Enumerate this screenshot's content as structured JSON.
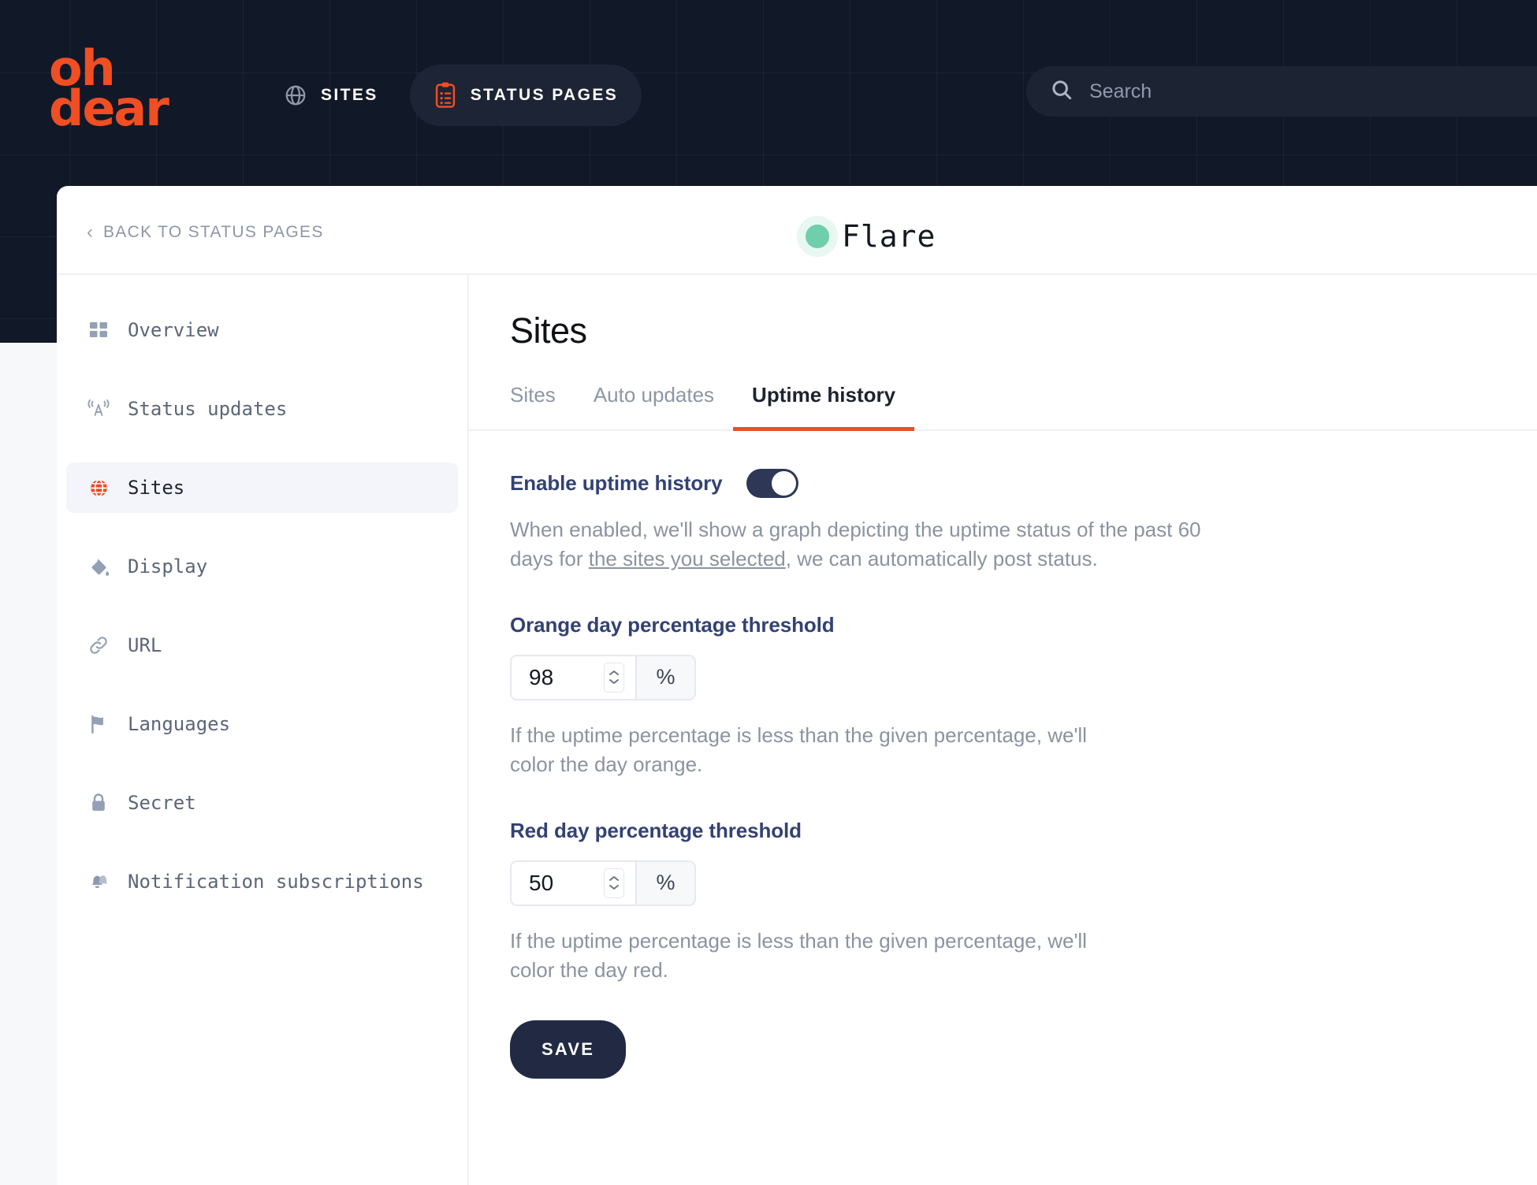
{
  "topnav": {
    "logo_line1": "oh",
    "logo_line2": "dear",
    "items": [
      {
        "label": "SITES",
        "icon": "globe-icon",
        "active": false
      },
      {
        "label": "STATUS PAGES",
        "icon": "clipboard-icon",
        "active": true
      }
    ],
    "search": {
      "placeholder": "Search",
      "icon": "search-icon"
    }
  },
  "card_header": {
    "back_label": "BACK TO STATUS PAGES",
    "back_icon": "chevron-left-icon",
    "status_icon": "green-status-dot",
    "title": "Flare"
  },
  "sidebar": {
    "items": [
      {
        "label": "Overview",
        "icon": "grid-icon",
        "active": false
      },
      {
        "label": "Status updates",
        "icon": "broadcast-icon",
        "active": false
      },
      {
        "label": "Sites",
        "icon": "globe-icon",
        "active": true
      },
      {
        "label": "Display",
        "icon": "paint-bucket-icon",
        "active": false
      },
      {
        "label": "URL",
        "icon": "link-icon",
        "active": false
      },
      {
        "label": "Languages",
        "icon": "flag-icon",
        "active": false
      },
      {
        "label": "Secret",
        "icon": "lock-icon",
        "active": false
      },
      {
        "label": "Notification subscriptions",
        "icon": "bells-icon",
        "active": false
      }
    ]
  },
  "main": {
    "title": "Sites",
    "tabs": [
      {
        "label": "Sites",
        "active": false
      },
      {
        "label": "Auto updates",
        "active": false
      },
      {
        "label": "Uptime history",
        "active": true
      }
    ],
    "enable_uptime": {
      "label": "Enable uptime history",
      "toggle_on": true,
      "helper_pre": "When enabled, we'll show a graph depicting the uptime status of the past 60 days for ",
      "helper_link": "the sites you selected",
      "helper_post": ", we can automatically post status."
    },
    "orange_threshold": {
      "label": "Orange day percentage threshold",
      "value": "98",
      "suffix": "%",
      "helper": "If the uptime percentage is less than the given percentage, we'll color the day orange."
    },
    "red_threshold": {
      "label": "Red day percentage threshold",
      "value": "50",
      "suffix": "%",
      "helper": "If the uptime percentage is less than the given percentage, we'll color the day red."
    },
    "save_label": "SAVE"
  },
  "colors": {
    "brand_orange": "#f04e23",
    "accent_orange": "#e8502a",
    "dark_navy": "#111827",
    "toggle_navy": "#2f3757",
    "label_blue": "#334273",
    "status_green": "#6fcfad",
    "save_navy": "#222a43"
  }
}
